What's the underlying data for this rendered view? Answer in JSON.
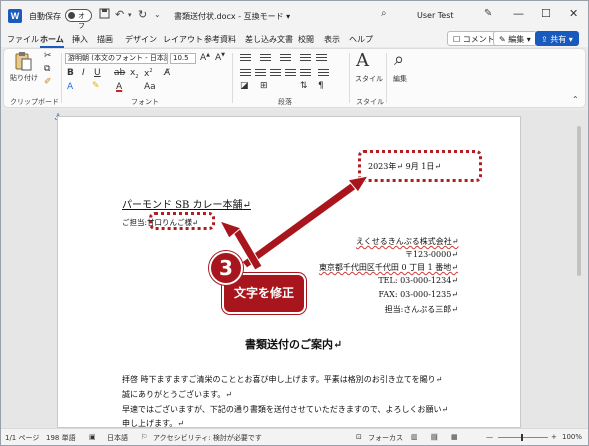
{
  "titlebar": {
    "app_logo": "W",
    "autosave_label": "自動保存",
    "autosave_state": "オフ",
    "save_icon": "save-icon",
    "undo_icon": "undo-icon",
    "redo_icon": "redo-icon",
    "doc_title": "書類送付状.docx  -  互換モード  ▾",
    "user_name": "User Test",
    "minimize": "—",
    "maximize": "☐",
    "close": "✕"
  },
  "menu": {
    "tabs": [
      "ファイル",
      "ホーム",
      "挿入",
      "描画",
      "デザイン",
      "レイアウト",
      "参考資料",
      "差し込み文書",
      "校閲",
      "表示",
      "ヘルプ"
    ],
    "active_tab": "ホーム",
    "comment_button": "コメント",
    "edit_button": "編集 ▾",
    "share_button": "共有 ▾"
  },
  "ribbon": {
    "paste_label": "貼り付け",
    "clipboard_group": "クリップボード",
    "font_name": "游明朝 (本文のフォント - 日本語",
    "font_size": "10.5",
    "font_group": "フォント",
    "paragraph_group": "段落",
    "style_label": "スタイル",
    "style_group": "スタイル",
    "edit_label": "編集"
  },
  "document": {
    "date": "2023年↵   9月  1日↵",
    "company_to": "パーモンド SB カレー本舗↵",
    "contact_to": "ご担当:甘口りんご様↵",
    "company_from": "えくせるきんぷる株式会社↵",
    "zip": "〒123-0000↵",
    "address": "東京都千代田区千代田   0 丁目 1 番地↵",
    "tel": "TEL: 03-000-1234↵",
    "fax": "FAX: 03-000-1235↵",
    "contact_from": "担当:さんぷる三郎↵",
    "heading": "書類送付のご案内↵",
    "body_1": "拝啓  時下ますますご清栄のこととお喜び申し上げます。平素は格別のお引き立てを賜り↵",
    "body_2": "誠にありがとうございます。↵",
    "body_3": "  早速ではございますが、下記の通り書類を送付させていただきますので、よろしくお願い↵",
    "body_4": "申し上げます。↵"
  },
  "annotation": {
    "step_number": "3",
    "step_text": "文字を修正",
    "color": "#a8151c"
  },
  "statusbar": {
    "page": "1/1 ページ",
    "words": "198 単語",
    "language": "日本語",
    "accessibility": "アクセシビリティ: 検討が必要です",
    "focus": "フォーカス",
    "zoom": "100%"
  }
}
